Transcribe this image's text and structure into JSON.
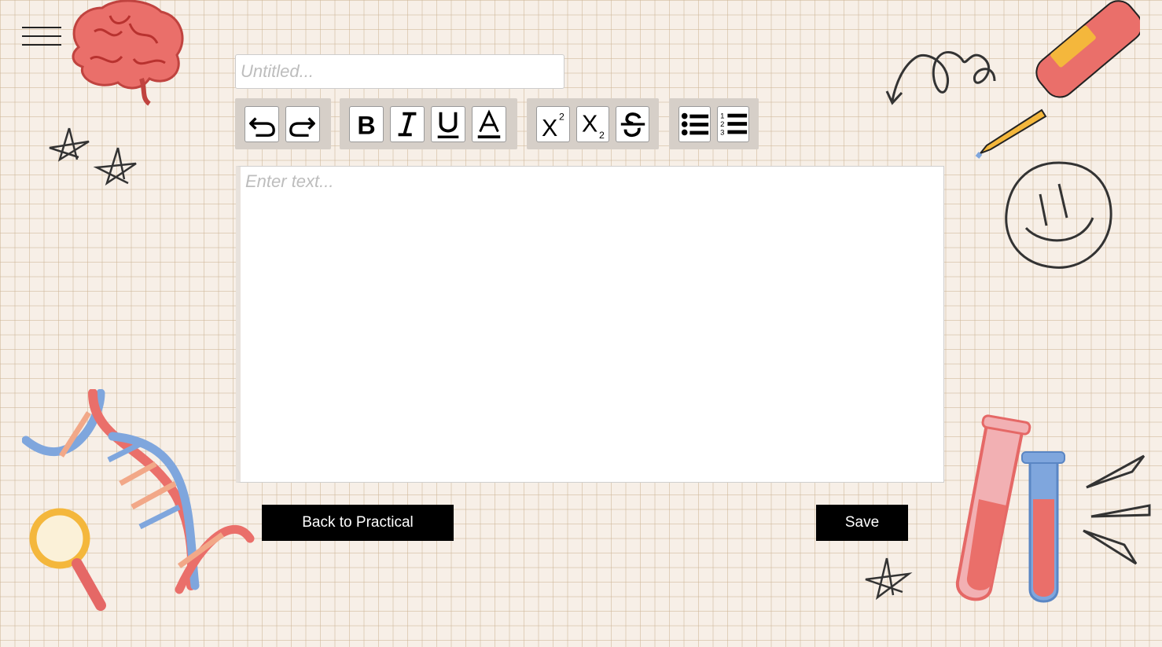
{
  "title_input": {
    "value": "",
    "placeholder": "Untitled..."
  },
  "editor": {
    "value": "",
    "placeholder": "Enter text..."
  },
  "toolbar": {
    "history": [
      "undo-icon",
      "redo-icon"
    ],
    "format": [
      "bold-icon",
      "italic-icon",
      "underline-icon",
      "font-color-icon"
    ],
    "script": [
      "superscript-icon",
      "subscript-icon",
      "strikethrough-icon"
    ],
    "lists": [
      "bulleted-list-icon",
      "numbered-list-icon"
    ]
  },
  "buttons": {
    "back_label": "Back to Practical",
    "save_label": "Save"
  },
  "colors": {
    "background": "#f7efe7",
    "grid": "#cdb496",
    "button_bg": "#000000",
    "toolbar_group": "#d6cfc8"
  }
}
